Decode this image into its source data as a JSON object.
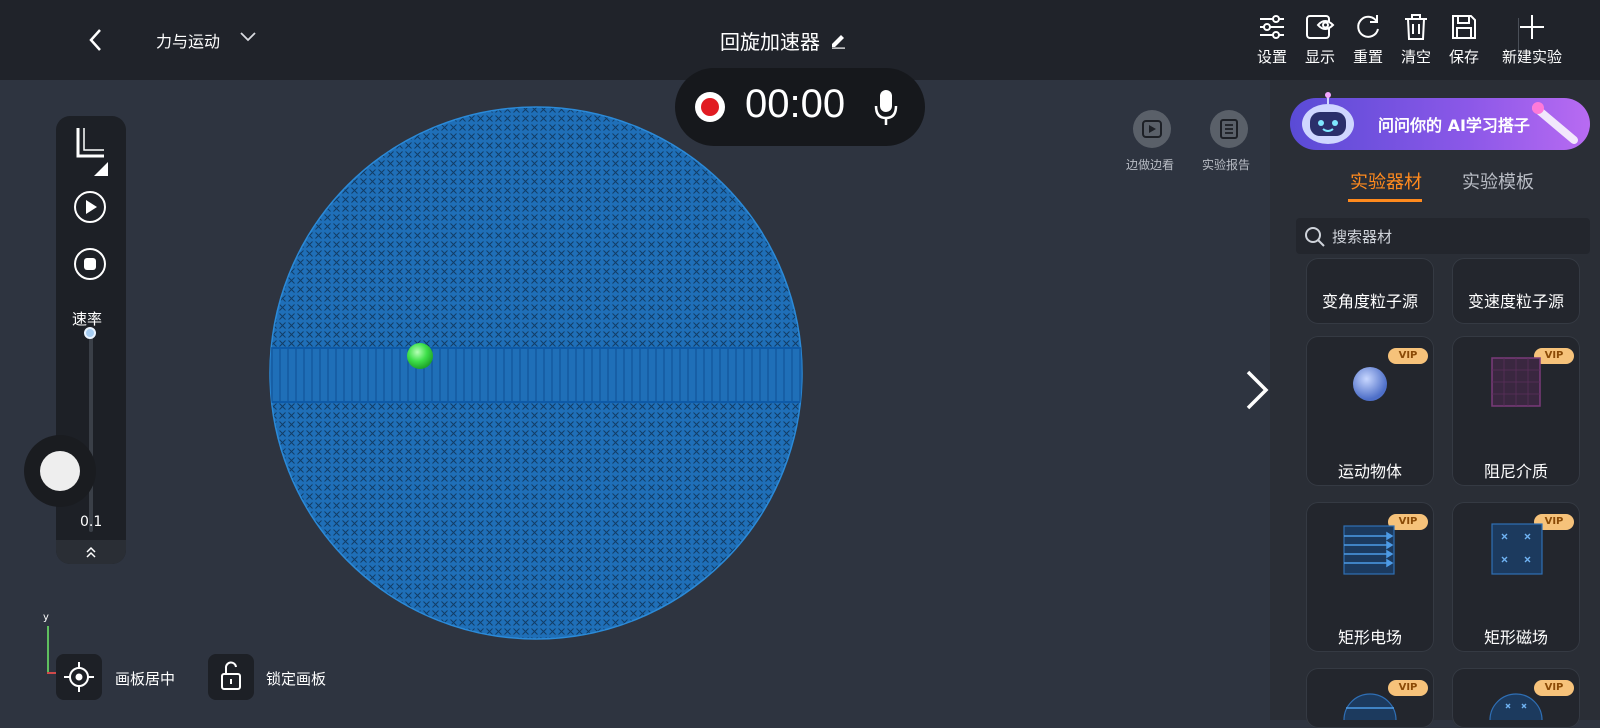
{
  "topbar": {
    "topic": "力与运动",
    "title": "回旋加速器",
    "tools": [
      {
        "label": "设置",
        "icon": "sliders-icon"
      },
      {
        "label": "显示",
        "icon": "eye-icon"
      },
      {
        "label": "重置",
        "icon": "refresh-icon"
      },
      {
        "label": "清空",
        "icon": "trash-icon"
      },
      {
        "label": "保存",
        "icon": "save-icon"
      },
      {
        "label": "新建实验",
        "icon": "plus-icon"
      }
    ]
  },
  "recording": {
    "time": "00:00"
  },
  "left_toolbar": {
    "speed_label": "速率",
    "speed_value": "0.1",
    "speed_fraction": 0.05
  },
  "canvas_buttons": {
    "watch_label": "边做边看",
    "report_label": "实验报告"
  },
  "bottom_controls": {
    "center_label": "画板居中",
    "lock_label": "锁定画板"
  },
  "axis": {
    "y_label": "y"
  },
  "right_panel": {
    "ai_banner": "问问你的 AI学习搭子",
    "tabs": [
      {
        "label": "实验器材",
        "active": true
      },
      {
        "label": "实验模板",
        "active": false
      }
    ],
    "search_placeholder": "搜索器材",
    "items": [
      {
        "label": "变角度粒子源",
        "vip": false
      },
      {
        "label": "变速度粒子源",
        "vip": false
      },
      {
        "label": "运动物体",
        "vip": true
      },
      {
        "label": "阻尼介质",
        "vip": true
      },
      {
        "label": "矩形电场",
        "vip": true
      },
      {
        "label": "矩形磁场",
        "vip": true
      },
      {
        "label": "",
        "vip": true
      },
      {
        "label": "",
        "vip": true
      }
    ],
    "vip_text": "VIP"
  },
  "colors": {
    "accent": "#ff8a1e",
    "field_blue": "#1f6fb8",
    "particle_green": "#3ee04a",
    "record_red": "#e11b22"
  }
}
